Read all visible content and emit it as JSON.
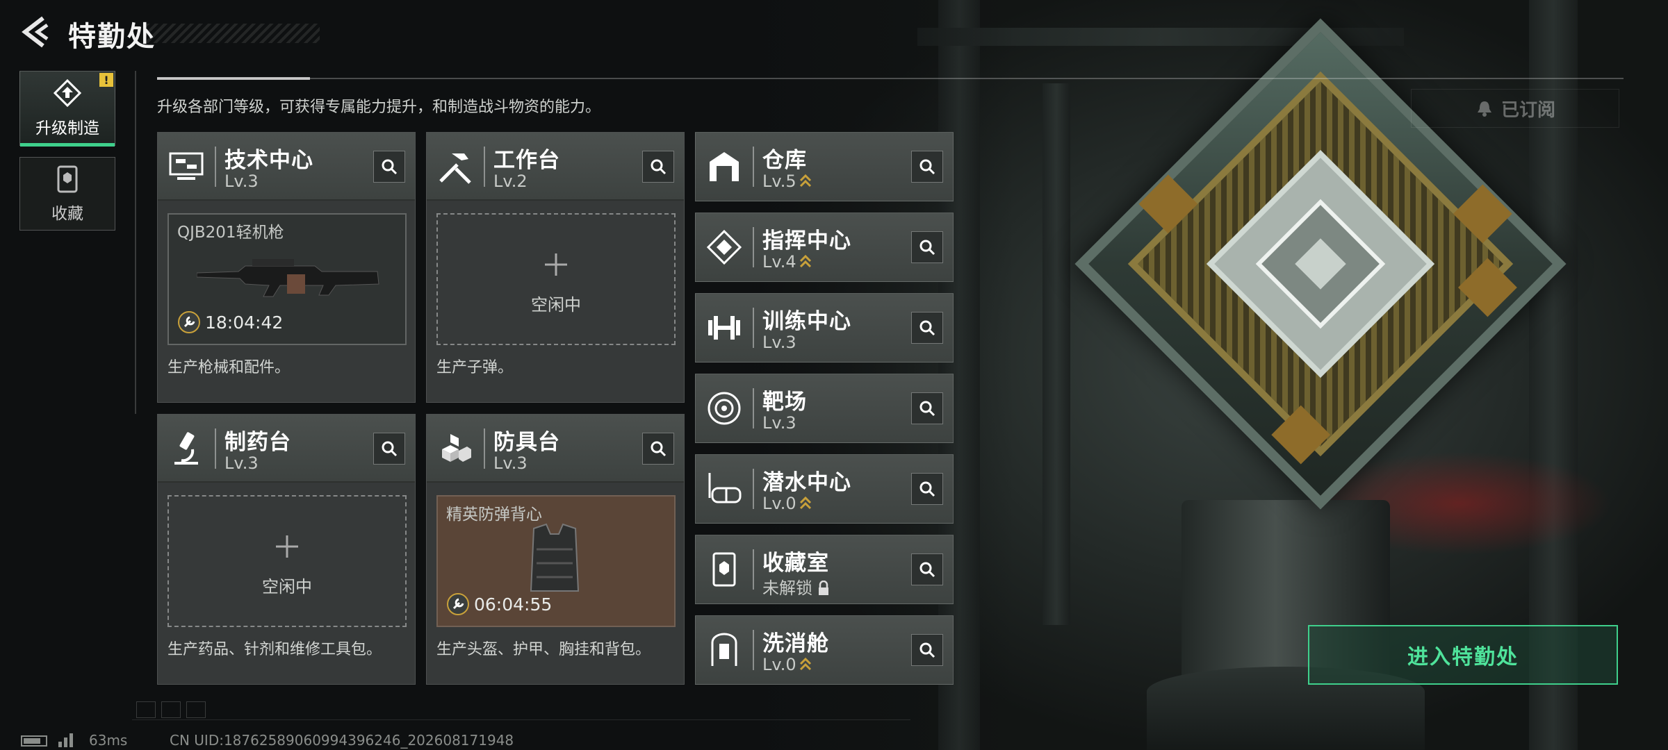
{
  "header": {
    "title": "特勤处",
    "subtitle": "升级各部门等级，可获得专属能力提升，和制造战斗物资的能力。"
  },
  "tabs": [
    {
      "label": "升级制造",
      "badge": "!",
      "icon": "upgrade-icon"
    },
    {
      "label": "收藏",
      "icon": "collection-icon"
    }
  ],
  "subscribed_label": "已订阅",
  "cards": {
    "tech": {
      "name": "技术中心",
      "level": "Lv.3",
      "item": "QJB201轻机枪",
      "time": "18:04:42",
      "desc": "生产枪械和配件。",
      "icon": "monitor-icon"
    },
    "workbench": {
      "name": "工作台",
      "level": "Lv.2",
      "idle": "空闲中",
      "desc": "生产子弹。",
      "icon": "tools-icon"
    },
    "pharmacy": {
      "name": "制药台",
      "level": "Lv.3",
      "idle": "空闲中",
      "desc": "生产药品、针剂和维修工具包。",
      "icon": "microscope-icon"
    },
    "armor": {
      "name": "防具台",
      "level": "Lv.3",
      "item": "精英防弹背心",
      "time": "06:04:55",
      "desc": "生产头盔、护甲、胸挂和背包。",
      "icon": "cubes-icon"
    }
  },
  "rooms": [
    {
      "name": "仓库",
      "level": "Lv.5",
      "upgradable": true,
      "icon": "warehouse-icon"
    },
    {
      "name": "指挥中心",
      "level": "Lv.4",
      "upgradable": true,
      "icon": "command-icon"
    },
    {
      "name": "训练中心",
      "level": "Lv.3",
      "upgradable": false,
      "icon": "dumbbell-icon"
    },
    {
      "name": "靶场",
      "level": "Lv.3",
      "upgradable": false,
      "icon": "target-icon"
    },
    {
      "name": "潜水中心",
      "level": "Lv.0",
      "upgradable": true,
      "icon": "diving-mask-icon"
    },
    {
      "name": "收藏室",
      "level": "未解锁",
      "locked": true,
      "icon": "collection-room-icon"
    },
    {
      "name": "洗消舱",
      "level": "Lv.0",
      "upgradable": true,
      "icon": "decon-icon"
    }
  ],
  "enter_button": "进入特勤处",
  "footer": {
    "ping": "63ms",
    "uid": "CN UID:1876258906099439624​6_202608171948"
  },
  "colors": {
    "accent": "#3fd08c",
    "upgrade_arrow": "#c9a13a",
    "badge": "#e8c23a"
  }
}
